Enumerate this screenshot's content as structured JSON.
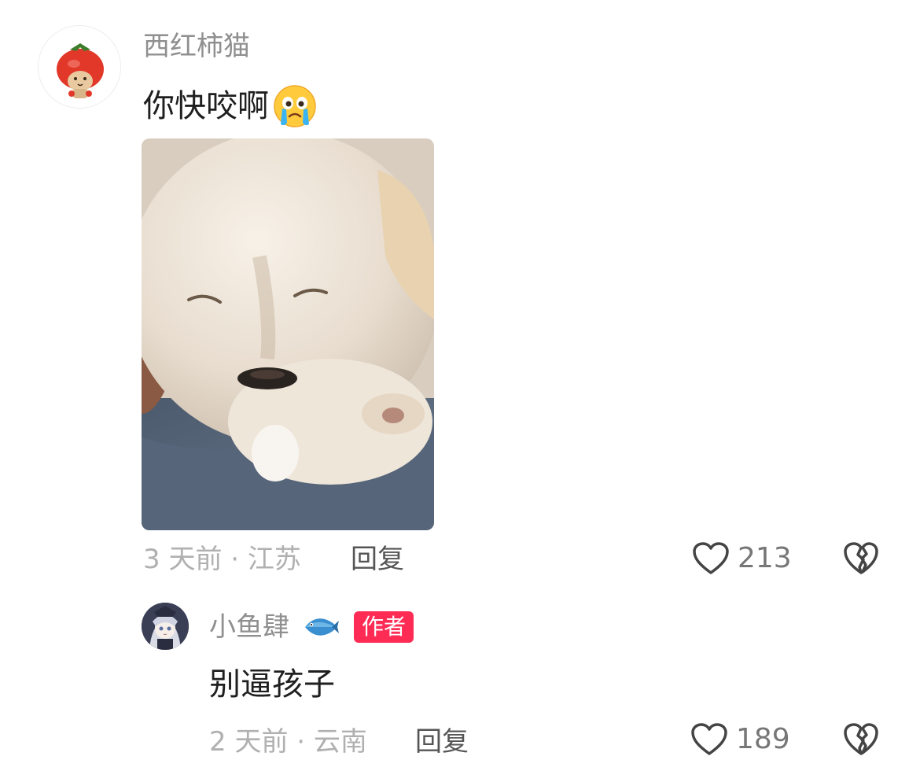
{
  "comment": {
    "username": "西红柿猫",
    "text": "你快咬啊",
    "text_emoji": "crying-face-emoji",
    "meta": "3 天前 · 江苏",
    "reply_label": "回复",
    "like_count": "213",
    "avatar_icon": "tomato-cat-avatar"
  },
  "reply": {
    "username": "小鱼肆",
    "name_emoji": "fish-emoji",
    "author_badge": "作者",
    "text": "别逼孩子",
    "meta": "2 天前 · 云南",
    "reply_label": "回复",
    "like_count": "189",
    "avatar_icon": "anime-girl-avatar"
  },
  "colors": {
    "badge": "#fe2c55",
    "username": "#8f8f8f",
    "meta": "#b0b0b0",
    "text": "#1f1f1f"
  }
}
